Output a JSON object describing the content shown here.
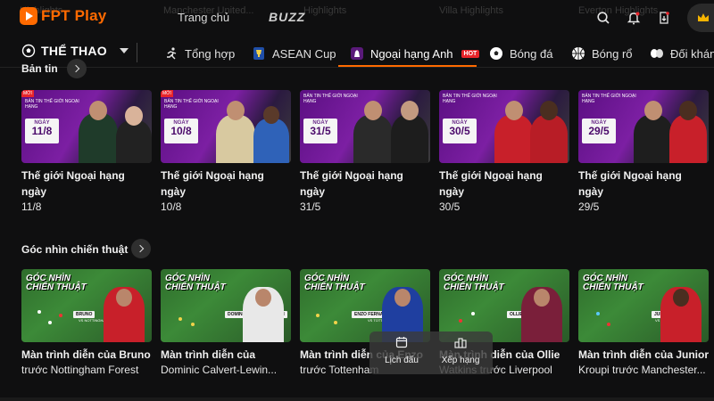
{
  "app": {
    "logo_text": "FPT Play",
    "accent": "#ff6a00"
  },
  "ghost_titles": [
    "Highlights",
    "Manchester United...",
    "Highlights",
    "Villa Highlights",
    "Everton Highlights"
  ],
  "topnav": {
    "home": "Trang chủ",
    "buzz": "BUZZ"
  },
  "top_icons": [
    "search-icon",
    "bell-icon",
    "download-icon",
    "crown-icon"
  ],
  "section": {
    "label": "THỂ THAO"
  },
  "categories": [
    {
      "label": "Tổng hợp",
      "icon": "running-icon"
    },
    {
      "label": "ASEAN Cup",
      "icon": "asean-cup-icon"
    },
    {
      "label": "Ngoại hạng Anh",
      "icon": "premier-league-icon",
      "badge": "HOT",
      "active": true
    },
    {
      "label": "Bóng đá",
      "icon": "football-icon"
    },
    {
      "label": "Bóng rổ",
      "icon": "basketball-icon"
    },
    {
      "label": "Đối kháng",
      "icon": "boxing-icon"
    }
  ],
  "news_section": {
    "title": "Bản tin",
    "thumb_header": "BẢN TIN THẾ GIỚI NGOẠI HẠNG",
    "thumb_new": "MỚI",
    "thumb_date_label": "NGÀY",
    "items": [
      {
        "date": "11/8",
        "title": "Thế giới Ngoại hạng ngày",
        "sub": "11/8"
      },
      {
        "date": "10/8",
        "title": "Thế giới Ngoại hạng ngày",
        "sub": "10/8"
      },
      {
        "date": "31/5",
        "title": "Thế giới Ngoại hạng ngày",
        "sub": "31/5"
      },
      {
        "date": "30/5",
        "title": "Thế giới Ngoại hạng ngày",
        "sub": "30/5"
      },
      {
        "date": "29/5",
        "title": "Thế giới Ngoại hạng ngày",
        "sub": "29/5"
      }
    ]
  },
  "tactics_section": {
    "title": "Góc nhìn chiến thuật",
    "thumb_header": "GÓC NHÌN CHIẾN THUẬT",
    "items": [
      {
        "tag": "BRUNO",
        "vs": "VS NOTTINGHAM",
        "title": "Màn trình diễn của Bruno",
        "sub": "trước Nottingham Forest"
      },
      {
        "tag": "DOMINIC CALVERT-LEWIN",
        "vs": "VS BRIGHTON",
        "title": "Màn trình diễn của",
        "sub": "Dominic Calvert-Lewin..."
      },
      {
        "tag": "ENZO FERNANDEZ",
        "vs": "VS TOTTENHAM",
        "title": "Màn trình diễn của Enzo",
        "sub": "trước Tottenham"
      },
      {
        "tag": "OLLIE WATKINS",
        "vs": "VS LIVERPOOL",
        "title": "Màn trình diễn của Ollie",
        "sub": "Watkins trước Liverpool"
      },
      {
        "tag": "JUNIOR KROUPI",
        "vs": "VS MANCHESTER CITY",
        "title": "Màn trình diễn của Junior",
        "sub": "Kroupi trước Manchester..."
      }
    ]
  },
  "float_nav": {
    "schedule": "Lịch đấu",
    "ranking": "Xếp hạng"
  }
}
